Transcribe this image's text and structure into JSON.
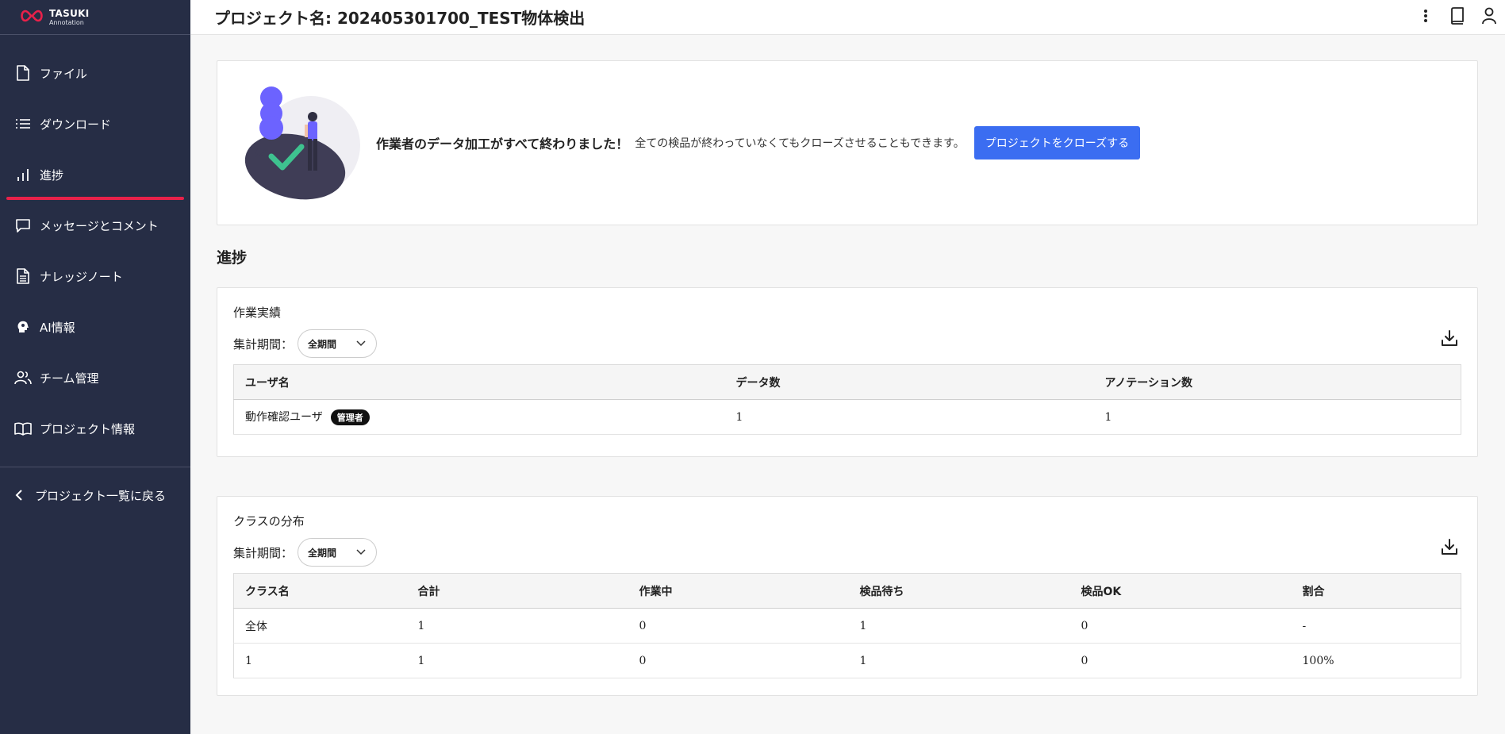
{
  "app": {
    "logo_main": "TASUKI",
    "logo_sub": "Annotation"
  },
  "sidebar": {
    "items": [
      {
        "label": "ファイル",
        "icon": "file-icon"
      },
      {
        "label": "ダウンロード",
        "icon": "list-icon"
      },
      {
        "label": "進捗",
        "icon": "bar-chart-icon",
        "active": true
      },
      {
        "label": "メッセージとコメント",
        "icon": "message-icon"
      },
      {
        "label": "ナレッジノート",
        "icon": "document-icon"
      },
      {
        "label": "AI情報",
        "icon": "ai-head-icon"
      },
      {
        "label": "チーム管理",
        "icon": "team-icon"
      },
      {
        "label": "プロジェクト情報",
        "icon": "book-open-icon"
      }
    ],
    "back_label": "プロジェクト一覧に戻る"
  },
  "header": {
    "title": "プロジェクト名: 202405301700_TEST物体検出"
  },
  "banner": {
    "strong_text": "作業者のデータ加工がすべて終わりました！",
    "sub_text": "全ての検品が終わっていなくてもクローズさせることもできます。",
    "close_button": "プロジェクトをクローズする"
  },
  "section_title": "進捗",
  "work_results": {
    "title": "作業実績",
    "period_label": "集計期間：",
    "period_value": "全期間",
    "columns": [
      "ユーザ名",
      "データ数",
      "アノテーション数"
    ],
    "rows": [
      {
        "user": "動作確認ユーザ",
        "badge": "管理者",
        "data_count": "1",
        "annotation_count": "1"
      }
    ]
  },
  "class_distribution": {
    "title": "クラスの分布",
    "period_label": "集計期間：",
    "period_value": "全期間",
    "columns": [
      "クラス名",
      "合計",
      "作業中",
      "検品待ち",
      "検品OK",
      "割合"
    ],
    "rows": [
      [
        "全体",
        "1",
        "0",
        "1",
        "0",
        "-"
      ],
      [
        "1",
        "1",
        "0",
        "1",
        "0",
        "100%"
      ]
    ]
  },
  "colors": {
    "sidebar_bg": "#262d45",
    "active_underline": "#e8214a",
    "primary_button": "#3b6df1",
    "illustration_purple": "#6c63ff",
    "illustration_green": "#3ec28f"
  }
}
